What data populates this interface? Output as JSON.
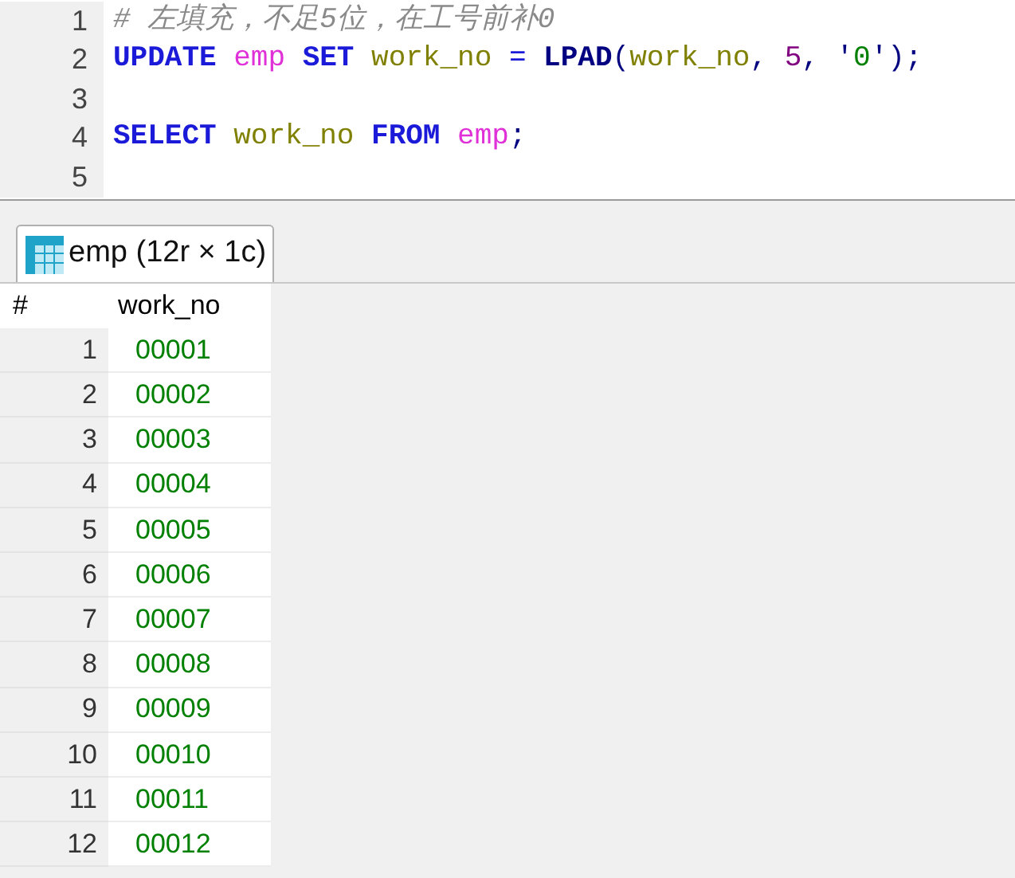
{
  "editor": {
    "lines": [
      {
        "number": "1",
        "tokens": [
          {
            "kind": "comment",
            "text": "# 左填充，不足5位，在工号前补0"
          }
        ]
      },
      {
        "number": "2",
        "tokens": [
          {
            "kind": "keyword",
            "text": "UPDATE"
          },
          {
            "kind": "table",
            "text": "emp",
            "spaced": true
          },
          {
            "kind": "keyword",
            "text": "SET",
            "spaced": true
          },
          {
            "kind": "column",
            "text": "work_no",
            "spaced": true
          },
          {
            "kind": "operator",
            "text": "=",
            "spaced": true
          },
          {
            "kind": "function",
            "text": "LPAD",
            "spaced": true
          },
          {
            "kind": "punct",
            "text": "("
          },
          {
            "kind": "column",
            "text": "work_no"
          },
          {
            "kind": "punct",
            "text": ","
          },
          {
            "kind": "number",
            "text": "5",
            "spaced": true
          },
          {
            "kind": "punct",
            "text": ","
          },
          {
            "kind": "punct",
            "text": "'",
            "spaced": true
          },
          {
            "kind": "string",
            "text": "0"
          },
          {
            "kind": "punct",
            "text": "');"
          }
        ]
      },
      {
        "number": "3"
      },
      {
        "number": "4",
        "tokens": [
          {
            "kind": "keyword",
            "text": "SELECT"
          },
          {
            "kind": "column",
            "text": "work_no",
            "spaced": true
          },
          {
            "kind": "keyword",
            "text": "FROM",
            "spaced": true
          },
          {
            "kind": "table",
            "text": "emp",
            "spaced": true
          },
          {
            "kind": "punct",
            "text": ";"
          }
        ]
      },
      {
        "number": "5"
      }
    ]
  },
  "result_tab": {
    "label": "emp (12r × 1c)",
    "selected": true
  },
  "table": {
    "columns": [
      "#",
      "work_no"
    ],
    "rows": [
      [
        "1",
        "00001"
      ],
      [
        "2",
        "00002"
      ],
      [
        "3",
        "00003"
      ],
      [
        "4",
        "00004"
      ],
      [
        "5",
        "00005"
      ],
      [
        "6",
        "00006"
      ],
      [
        "7",
        "00007"
      ],
      [
        "8",
        "00008"
      ],
      [
        "9",
        "00009"
      ],
      [
        "10",
        "00010"
      ],
      [
        "11",
        "00011"
      ],
      [
        "12",
        "00012"
      ]
    ]
  }
}
